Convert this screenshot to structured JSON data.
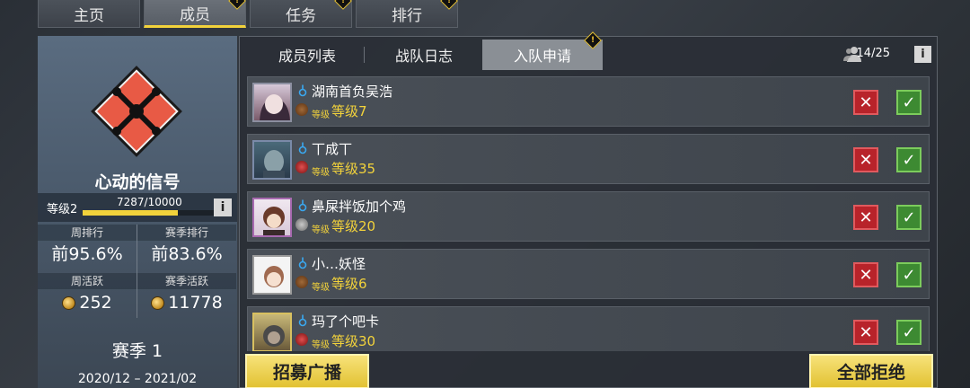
{
  "top_tabs": [
    {
      "label": "主页",
      "active": false,
      "alert": false
    },
    {
      "label": "成员",
      "active": true,
      "alert": true
    },
    {
      "label": "任务",
      "active": false,
      "alert": true
    },
    {
      "label": "排行",
      "active": false,
      "alert": true
    }
  ],
  "team": {
    "name": "心动的信号",
    "level_label": "等级2",
    "exp_text": "7287/10000",
    "exp_fraction": 0.7287,
    "info": "i",
    "stats": {
      "weekly_rank_label": "周排行",
      "weekly_rank_value": "前95.6%",
      "season_rank_label": "赛季排行",
      "season_rank_value": "前83.6%",
      "weekly_active_label": "周活跃",
      "weekly_active_value": "252",
      "season_active_label": "赛季活跃",
      "season_active_value": "11778"
    },
    "season_label": "赛季 1",
    "season_range": "2020/12 – 2021/02"
  },
  "sub_tabs": [
    {
      "label": "成员列表",
      "active": false
    },
    {
      "label": "战队日志",
      "active": false
    },
    {
      "label": "入队申请",
      "active": true
    }
  ],
  "member_count": "14/25",
  "info": "i",
  "applicants": [
    {
      "name": "湖南首负吴浩",
      "level_small": "等级",
      "level": "等级7",
      "reject": "✕",
      "accept": "✓"
    },
    {
      "name": "丅成丅",
      "level_small": "等级",
      "level": "等级35",
      "reject": "✕",
      "accept": "✓"
    },
    {
      "name": "鼻屎拌饭加个鸡",
      "level_small": "等级",
      "level": "等级20",
      "reject": "✕",
      "accept": "✓"
    },
    {
      "name": "小…妖怪",
      "level_small": "等级",
      "level": "等级6",
      "reject": "✕",
      "accept": "✓"
    },
    {
      "name": "玛了个吧卡",
      "level_small": "等级",
      "level": "等级30",
      "reject": "✕",
      "accept": "✓"
    }
  ],
  "buttons": {
    "recruit": "招募广播",
    "reject_all": "全部拒绝"
  },
  "colors": {
    "accent_yellow": "#f2d23b",
    "reject_red": "#b8232a",
    "accept_green": "#3d8a32",
    "emblem_orange": "#e85a45"
  }
}
